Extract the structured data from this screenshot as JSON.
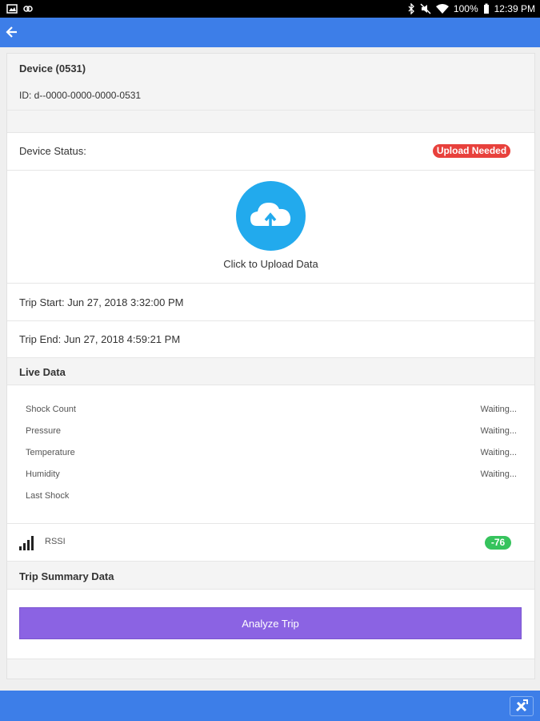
{
  "status_bar": {
    "battery": "100%",
    "time": "12:39 PM"
  },
  "device": {
    "title": "Device (0531)",
    "id_line": "ID: d--0000-0000-0000-0531"
  },
  "status": {
    "label": "Device Status:",
    "badge": "Upload Needed",
    "badge_color": "#e8413c"
  },
  "upload": {
    "label": "Click to Upload Data"
  },
  "trip": {
    "start": "Trip Start: Jun 27, 2018 3:32:00 PM",
    "end": "Trip End: Jun 27, 2018 4:59:21 PM"
  },
  "live": {
    "header": "Live Data",
    "rows": [
      {
        "label": "Shock Count",
        "value": "Waiting..."
      },
      {
        "label": "Pressure",
        "value": "Waiting..."
      },
      {
        "label": "Temperature",
        "value": "Waiting..."
      },
      {
        "label": "Humidity",
        "value": "Waiting..."
      },
      {
        "label": "Last Shock",
        "value": ""
      }
    ]
  },
  "rssi": {
    "label": "RSSI",
    "value": "-76",
    "badge_color": "#36c35d"
  },
  "summary": {
    "header": "Trip Summary Data",
    "button": "Analyze Trip"
  },
  "colors": {
    "appbar": "#3d7ee8",
    "upload_circle": "#22aaed",
    "analyze_button": "#8b63e3"
  },
  "icons": [
    "back-arrow-icon",
    "cloud-upload-icon",
    "signal-bars-icon",
    "tools-icon"
  ]
}
